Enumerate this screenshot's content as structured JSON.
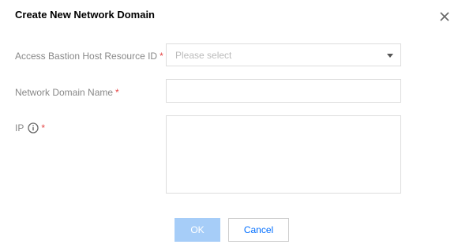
{
  "dialog": {
    "title": "Create New Network Domain",
    "close_icon": "close-icon"
  },
  "form": {
    "resource_id": {
      "label": "Access Bastion Host Resource ID",
      "required_mark": "*",
      "placeholder": "Please select",
      "icon": "chevron-down-icon"
    },
    "domain_name": {
      "label": "Network Domain Name",
      "required_mark": "*",
      "value": ""
    },
    "ip": {
      "label": "IP",
      "required_mark": "*",
      "info_icon": "info-icon",
      "value": ""
    }
  },
  "buttons": {
    "ok_label": "OK",
    "cancel_label": "Cancel"
  },
  "colors": {
    "primary_disabled": "#a6cdf8",
    "link": "#006eff",
    "required": "#e54545",
    "label": "#888888",
    "border": "#dddddd"
  }
}
